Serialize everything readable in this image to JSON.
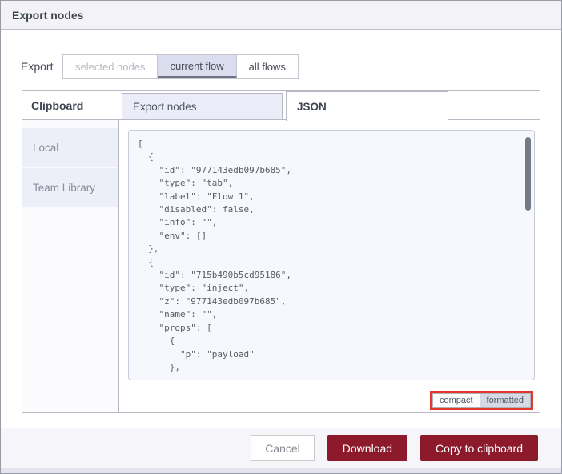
{
  "dialog": {
    "title": "Export nodes"
  },
  "export_scope": {
    "label": "Export",
    "options": [
      {
        "label": "selected nodes",
        "state": "disabled"
      },
      {
        "label": "current flow",
        "state": "selected"
      },
      {
        "label": "all flows",
        "state": "default"
      }
    ]
  },
  "library": {
    "clipboard_tab": "Clipboard",
    "tabs": [
      {
        "label": "Export nodes",
        "active": false
      },
      {
        "label": "JSON",
        "active": true
      }
    ],
    "sidebar": [
      {
        "label": "Local"
      },
      {
        "label": "Team Library"
      }
    ]
  },
  "editor": {
    "json_text": "[\n  {\n    \"id\": \"977143edb097b685\",\n    \"type\": \"tab\",\n    \"label\": \"Flow 1\",\n    \"disabled\": false,\n    \"info\": \"\",\n    \"env\": []\n  },\n  {\n    \"id\": \"715b490b5cd95186\",\n    \"type\": \"inject\",\n    \"z\": \"977143edb097b685\",\n    \"name\": \"\",\n    \"props\": [\n      {\n        \"p\": \"payload\"\n      },",
    "format_toggle": {
      "compact_label": "compact",
      "formatted_label": "formatted",
      "selected": "formatted"
    }
  },
  "footer": {
    "cancel_label": "Cancel",
    "download_label": "Download",
    "copy_label": "Copy to clipboard"
  },
  "colors": {
    "primary_button": "#8C1A2B",
    "titlebar_bg": "#F2F2F8",
    "tab_inactive_bg": "#EAECF7",
    "selected_toggle_bg": "#DADDED",
    "sidebar_item_bg": "#EDEFF8",
    "editor_bg": "#F7F8FD",
    "highlight_red": "#E3382C"
  }
}
